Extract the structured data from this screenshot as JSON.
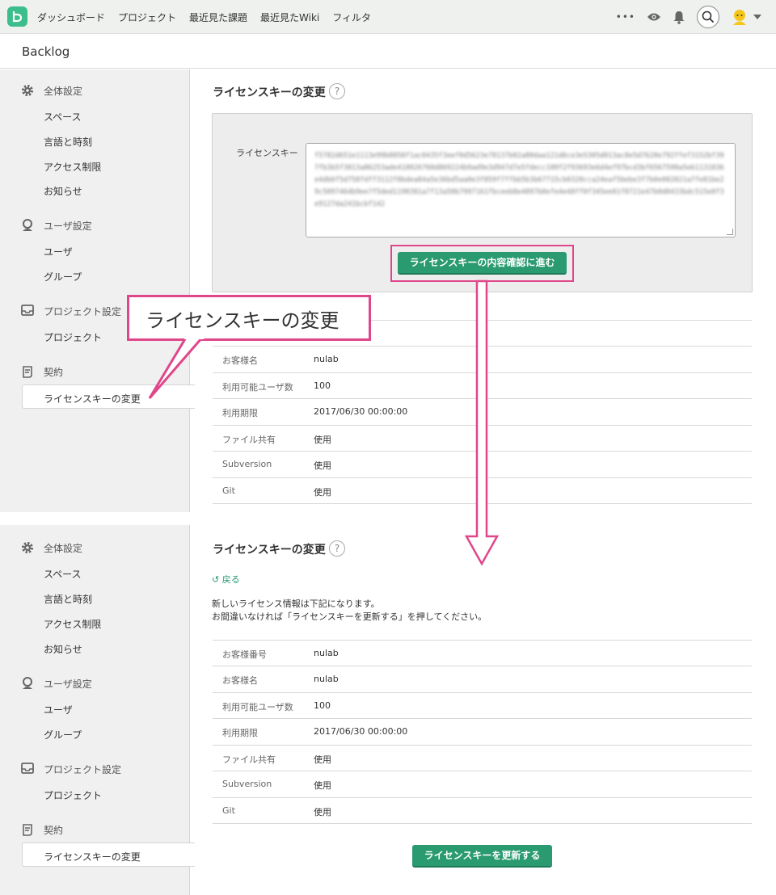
{
  "nav": {
    "links": [
      "ダッシュボード",
      "プロジェクト",
      "最近見た課題",
      "最近見たWiki",
      "フィルタ"
    ],
    "more": "•••"
  },
  "project": {
    "name": "Backlog"
  },
  "sidebar": {
    "general_title": "全体設定",
    "general_items": [
      "スペース",
      "言語と時刻",
      "アクセス制限",
      "お知らせ"
    ],
    "user_title": "ユーザ設定",
    "user_items": [
      "ユーザ",
      "グループ"
    ],
    "project_title": "プロジェクト設定",
    "project_items": [
      "プロジェクト"
    ],
    "contract_title": "契約",
    "contract_active": "ライセンスキーの変更"
  },
  "page": {
    "title": "ライセンスキーの変更",
    "help": "?"
  },
  "top_screen": {
    "license_label": "ライセンスキー",
    "license_value": "f5782d651e1113e99b8858f1ac0435f3eef0d5623e78137b02a80daa121d6ce3e5305d013ac8e5d7628e792ffef3152bf397fb3b5f3013a86253ade418026760d869224b9ad9e3d947d7e5fdecc109f2f93693e6d4ef97bcd3bf6567598a5eb1131036e4db6f5d758fdff3112f8bdea84a5e36bd5aa0e3f859f7ffbb5b3b67715cb0320cca24eaf5bebe3f7b0e082021a7fe81be29c5097464b9ee7f5ded1198381a7f13a50b7997161fbceeb8e4897b0efe4e48ff0f345ee01f8721e47b0d0433bdc515e0f3e9127da241bcbf142",
    "confirm_button": "ライセンスキーの内容確認に進む",
    "rows": [
      {
        "key": "お客様名",
        "value": "nulab"
      },
      {
        "key": "利用可能ユーザ数",
        "value": "100"
      },
      {
        "key": "利用期限",
        "value": "2017/06/30 00:00:00"
      },
      {
        "key": "ファイル共有",
        "value": "使用"
      },
      {
        "key": "Subversion",
        "value": "使用"
      },
      {
        "key": "Git",
        "value": "使用"
      }
    ]
  },
  "callout": {
    "text": "ライセンスキーの変更"
  },
  "bottom_screen": {
    "back": "戻る",
    "message_line1": "新しいライセンス情報は下記になります。",
    "message_line2": "お間違いなければ「ライセンスキーを更新する」を押してください。",
    "rows": [
      {
        "key": "お客様番号",
        "value": "nulab"
      },
      {
        "key": "お客様名",
        "value": "nulab"
      },
      {
        "key": "利用可能ユーザ数",
        "value": "100"
      },
      {
        "key": "利用期限",
        "value": "2017/06/30 00:00:00"
      },
      {
        "key": "ファイル共有",
        "value": "使用"
      },
      {
        "key": "Subversion",
        "value": "使用"
      },
      {
        "key": "Git",
        "value": "使用"
      }
    ],
    "update_button": "ライセンスキーを更新する"
  },
  "colors": {
    "accent": "#2a9a71",
    "highlight": "#e0468a",
    "logo": "#3cbd8c"
  }
}
